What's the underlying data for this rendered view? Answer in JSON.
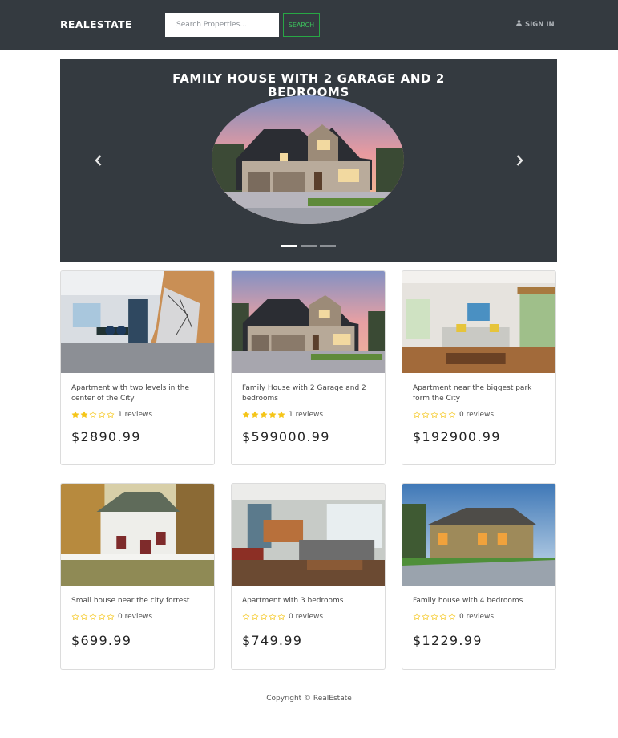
{
  "navbar": {
    "brand": "REALESTATE",
    "search_placeholder": "Search Properties...",
    "search_button": "SEARCH",
    "signin_label": "SIGN IN"
  },
  "carousel": {
    "title": "FAMILY HOUSE WITH 2 GARAGE AND 2 BEDROOMS",
    "slide_count": 3,
    "active_slide": 1
  },
  "listings": [
    {
      "title": "Apartment with two levels in the center of the City",
      "rating": 2,
      "reviews_label": "1 reviews",
      "price": "$2890.99",
      "image": "modern-apartment-interior"
    },
    {
      "title": "Family House with 2 Garage and 2 bedrooms",
      "rating": 5,
      "reviews_label": "1 reviews",
      "price": "$599000.99",
      "image": "family-house-exterior"
    },
    {
      "title": "Apartment near the biggest park form the City",
      "rating": 0,
      "reviews_label": "0 reviews",
      "price": "$192900.99",
      "image": "living-room-interior"
    },
    {
      "title": "Small house near the city forrest",
      "rating": 0,
      "reviews_label": "0 reviews",
      "price": "$699.99",
      "image": "small-white-house"
    },
    {
      "title": "Apartment with 3 bedrooms",
      "rating": 0,
      "reviews_label": "0 reviews",
      "price": "$749.99",
      "image": "open-plan-living-room"
    },
    {
      "title": "Family house with 4 bedrooms",
      "rating": 0,
      "reviews_label": "0 reviews",
      "price": "$1229.99",
      "image": "suburban-house-dusk"
    }
  ],
  "footer": {
    "copyright": "Copyright © RealEstate"
  },
  "colors": {
    "navbar_bg": "#343a40",
    "accent_green": "#28a745",
    "star_gold": "#f5c518"
  }
}
